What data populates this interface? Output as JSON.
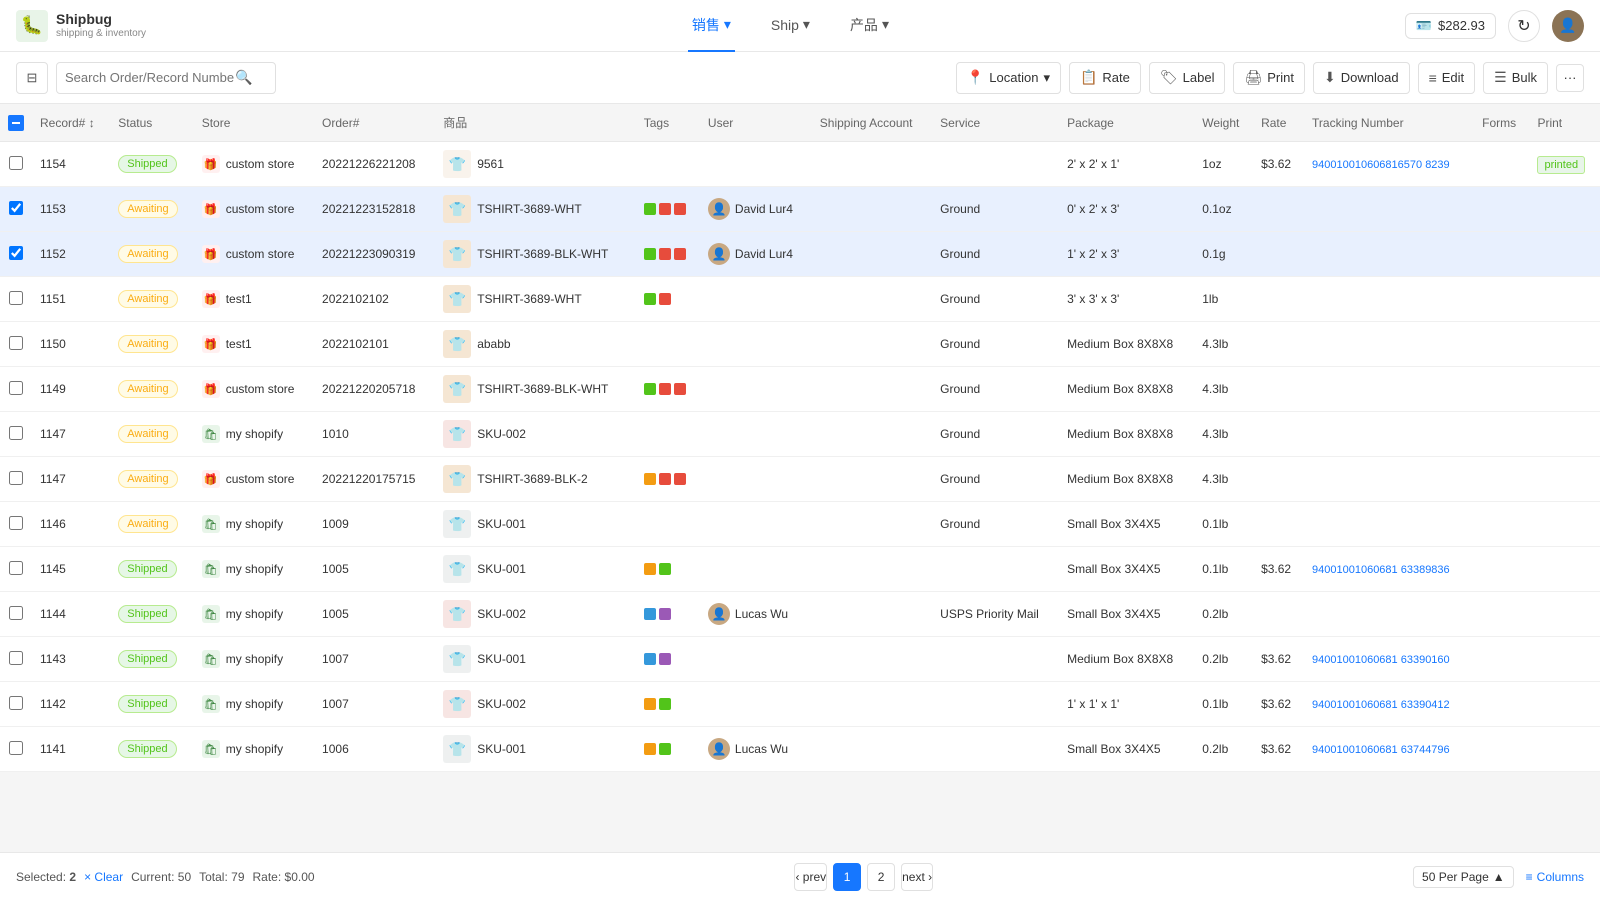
{
  "app": {
    "logo_emoji": "🐛",
    "logo_name": "Shipbug",
    "logo_sub": "shipping & inventory"
  },
  "nav": {
    "items": [
      {
        "label": "销售",
        "active": true,
        "has_dropdown": true
      },
      {
        "label": "Ship",
        "active": false,
        "has_dropdown": true
      },
      {
        "label": "产品",
        "active": false,
        "has_dropdown": true
      }
    ],
    "balance": "$282.93",
    "balance_icon": "💳"
  },
  "toolbar": {
    "search_placeholder": "Search Order/Record Number",
    "location_label": "Location",
    "rate_label": "Rate",
    "label_label": "Label",
    "print_label": "Print",
    "download_label": "Download",
    "edit_label": "Edit",
    "bulk_label": "Bulk"
  },
  "table": {
    "columns": [
      "Record#",
      "Status",
      "Store",
      "Order#",
      "商品",
      "Tags",
      "User",
      "Shipping Account",
      "Service",
      "Package",
      "Weight",
      "Rate",
      "Tracking Number",
      "Forms",
      "Print"
    ],
    "rows": [
      {
        "id": "row-1154",
        "record": "1154",
        "status": "Shipped",
        "status_type": "shipped",
        "store": "custom store",
        "store_type": "gift",
        "order": "20221226221208",
        "product": "9561",
        "product_color": "#d4a574",
        "tags": [],
        "user": "",
        "shipping_account": "",
        "service": "",
        "package": "2' x 2' x 1'",
        "weight": "1oz",
        "rate": "$3.62",
        "tracking": "940010010606816570 8239",
        "tracking_full": "94001001060681657O8239",
        "forms": "",
        "print": "printed",
        "selected": false
      },
      {
        "id": "row-1153",
        "record": "1153",
        "status": "Awaiting",
        "status_type": "awaiting",
        "store": "custom store",
        "store_type": "gift",
        "order": "20221223152818",
        "product": "TSHIRT-3689-WHT",
        "product_color": "#555",
        "tags": [
          "#52c41a",
          "#e74c3c",
          "#e74c3c"
        ],
        "user": "David Lur4",
        "user_avatar": true,
        "shipping_account": "",
        "service": "Ground",
        "package": "0' x 2' x 3'",
        "weight": "0.1oz",
        "rate": "",
        "tracking": "",
        "forms": "",
        "print": "",
        "selected": true
      },
      {
        "id": "row-1152",
        "record": "1152",
        "status": "Awaiting",
        "status_type": "awaiting",
        "store": "custom store",
        "store_type": "gift",
        "order": "20221223090319",
        "product": "TSHIRT-3689-BLK-WHT",
        "product_color": "#222",
        "tags": [
          "#52c41a",
          "#e74c3c",
          "#e74c3c"
        ],
        "user": "David Lur4",
        "user_avatar": true,
        "shipping_account": "",
        "service": "Ground",
        "package": "1' x 2' x 3'",
        "weight": "0.1g",
        "rate": "",
        "tracking": "",
        "forms": "",
        "print": "",
        "selected": true
      },
      {
        "id": "row-1151",
        "record": "1151",
        "status": "Awaiting",
        "status_type": "awaiting",
        "store": "test1",
        "store_type": "gift",
        "order": "2022102102",
        "product": "TSHIRT-3689-WHT",
        "product_color": "#555",
        "tags": [
          "#52c41a",
          "#e74c3c"
        ],
        "user": "",
        "shipping_account": "",
        "service": "Ground",
        "package": "3' x 3' x 3'",
        "weight": "1lb",
        "rate": "",
        "tracking": "",
        "forms": "",
        "print": "",
        "selected": false
      },
      {
        "id": "row-1150",
        "record": "1150",
        "status": "Awaiting",
        "status_type": "awaiting",
        "store": "test1",
        "store_type": "gift",
        "order": "2022102101",
        "product": "ababb",
        "product_color": "#888",
        "tags": [],
        "user": "",
        "shipping_account": "",
        "service": "Ground",
        "package": "Medium Box 8X8X8",
        "weight": "4.3lb",
        "rate": "",
        "tracking": "",
        "forms": "",
        "print": "",
        "selected": false
      },
      {
        "id": "row-1149",
        "record": "1149",
        "status": "Awaiting",
        "status_type": "awaiting",
        "store": "custom store",
        "store_type": "gift",
        "order": "20221220205718",
        "product": "TSHIRT-3689-BLK-WHT",
        "product_color": "#222",
        "tags": [
          "#52c41a",
          "#e74c3c",
          "#e74c3c"
        ],
        "user": "",
        "shipping_account": "",
        "service": "Ground",
        "package": "Medium Box 8X8X8",
        "weight": "4.3lb",
        "rate": "",
        "tracking": "",
        "forms": "",
        "print": "",
        "selected": false
      },
      {
        "id": "row-1147a",
        "record": "1147",
        "status": "Awaiting",
        "status_type": "awaiting",
        "store": "my shopify",
        "store_type": "shopify",
        "order": "1010",
        "product": "SKU-002",
        "product_color": "#c0392b",
        "tags": [],
        "user": "",
        "shipping_account": "",
        "service": "Ground",
        "package": "Medium Box 8X8X8",
        "weight": "4.3lb",
        "rate": "",
        "tracking": "",
        "forms": "",
        "print": "",
        "selected": false
      },
      {
        "id": "row-1147b",
        "record": "1147",
        "status": "Awaiting",
        "status_type": "awaiting",
        "store": "custom store",
        "store_type": "gift",
        "order": "20221220175715",
        "product": "TSHIRT-3689-BLK-2",
        "product_color": "#222",
        "tags": [
          "#f39c12",
          "#e74c3c",
          "#e74c3c"
        ],
        "user": "",
        "shipping_account": "",
        "service": "Ground",
        "package": "Medium Box 8X8X8",
        "weight": "4.3lb",
        "rate": "",
        "tracking": "",
        "forms": "",
        "print": "",
        "selected": false
      },
      {
        "id": "row-1146",
        "record": "1146",
        "status": "Awaiting",
        "status_type": "awaiting",
        "store": "my shopify",
        "store_type": "shopify",
        "order": "1009",
        "product": "SKU-001",
        "product_color": "#7f8c8d",
        "tags": [],
        "user": "",
        "shipping_account": "",
        "service": "Ground",
        "package": "Small Box 3X4X5",
        "weight": "0.1lb",
        "rate": "",
        "tracking": "",
        "forms": "",
        "print": "",
        "selected": false
      },
      {
        "id": "row-1145",
        "record": "1145",
        "status": "Shipped",
        "status_type": "shipped",
        "store": "my shopify",
        "store_type": "shopify",
        "order": "1005",
        "product": "SKU-001",
        "product_color": "#7f8c8d",
        "tags": [
          "#f39c12",
          "#52c41a"
        ],
        "user": "",
        "shipping_account": "",
        "service": "",
        "package": "Small Box 3X4X5",
        "weight": "0.1lb",
        "rate": "$3.62",
        "tracking": "94001001060681 63389836",
        "tracking_full": "94001001060681 63389836",
        "forms": "",
        "print": "",
        "selected": false
      },
      {
        "id": "row-1144",
        "record": "1144",
        "status": "Shipped",
        "status_type": "shipped",
        "store": "my shopify",
        "store_type": "shopify",
        "order": "1005",
        "product": "SKU-002",
        "product_color": "#c0392b",
        "tags": [
          "#3498db",
          "#9b59b6"
        ],
        "user": "Lucas Wu",
        "user_avatar2": true,
        "shipping_account": "",
        "service": "USPS Priority Mail",
        "package": "Small Box 3X4X5",
        "weight": "0.2lb",
        "rate": "",
        "tracking": "",
        "forms": "",
        "print": "",
        "selected": false
      },
      {
        "id": "row-1143",
        "record": "1143",
        "status": "Shipped",
        "status_type": "shipped",
        "store": "my shopify",
        "store_type": "shopify",
        "order": "1007",
        "product": "SKU-001",
        "product_color": "#7f8c8d",
        "tags": [
          "#3498db",
          "#9b59b6"
        ],
        "user": "",
        "shipping_account": "",
        "service": "",
        "package": "Medium Box 8X8X8",
        "weight": "0.2lb",
        "rate": "$3.62",
        "tracking": "94001001060681 63390160",
        "forms": "",
        "print": "",
        "selected": false
      },
      {
        "id": "row-1142",
        "record": "1142",
        "status": "Shipped",
        "status_type": "shipped",
        "store": "my shopify",
        "store_type": "shopify",
        "order": "1007",
        "product": "SKU-002",
        "product_color": "#c0392b",
        "tags": [
          "#f39c12",
          "#52c41a"
        ],
        "user": "",
        "shipping_account": "",
        "service": "",
        "package": "1' x 1' x 1'",
        "weight": "0.1lb",
        "rate": "$3.62",
        "tracking": "94001001060681 63390412",
        "forms": "",
        "print": "",
        "selected": false
      },
      {
        "id": "row-1141",
        "record": "1141",
        "status": "Shipped",
        "status_type": "shipped",
        "store": "my shopify",
        "store_type": "shopify",
        "order": "1006",
        "product": "SKU-001",
        "product_color": "#7f8c8d",
        "tags": [
          "#f39c12",
          "#52c41a"
        ],
        "user": "Lucas Wu",
        "user_avatar2": true,
        "shipping_account": "",
        "service": "",
        "package": "Small Box 3X4X5",
        "weight": "0.2lb",
        "rate": "$3.62",
        "tracking": "94001001060681 63744796",
        "forms": "",
        "print": "",
        "selected": false
      }
    ]
  },
  "footer": {
    "selected_count": "2",
    "clear_label": "Clear",
    "current_label": "Current: 50",
    "total_label": "Total: 79",
    "rate_label": "Rate: $0.00",
    "prev_label": "prev",
    "next_label": "next",
    "page1": "1",
    "page2": "2",
    "per_page": "50 Per Page",
    "columns_label": "Columns"
  }
}
